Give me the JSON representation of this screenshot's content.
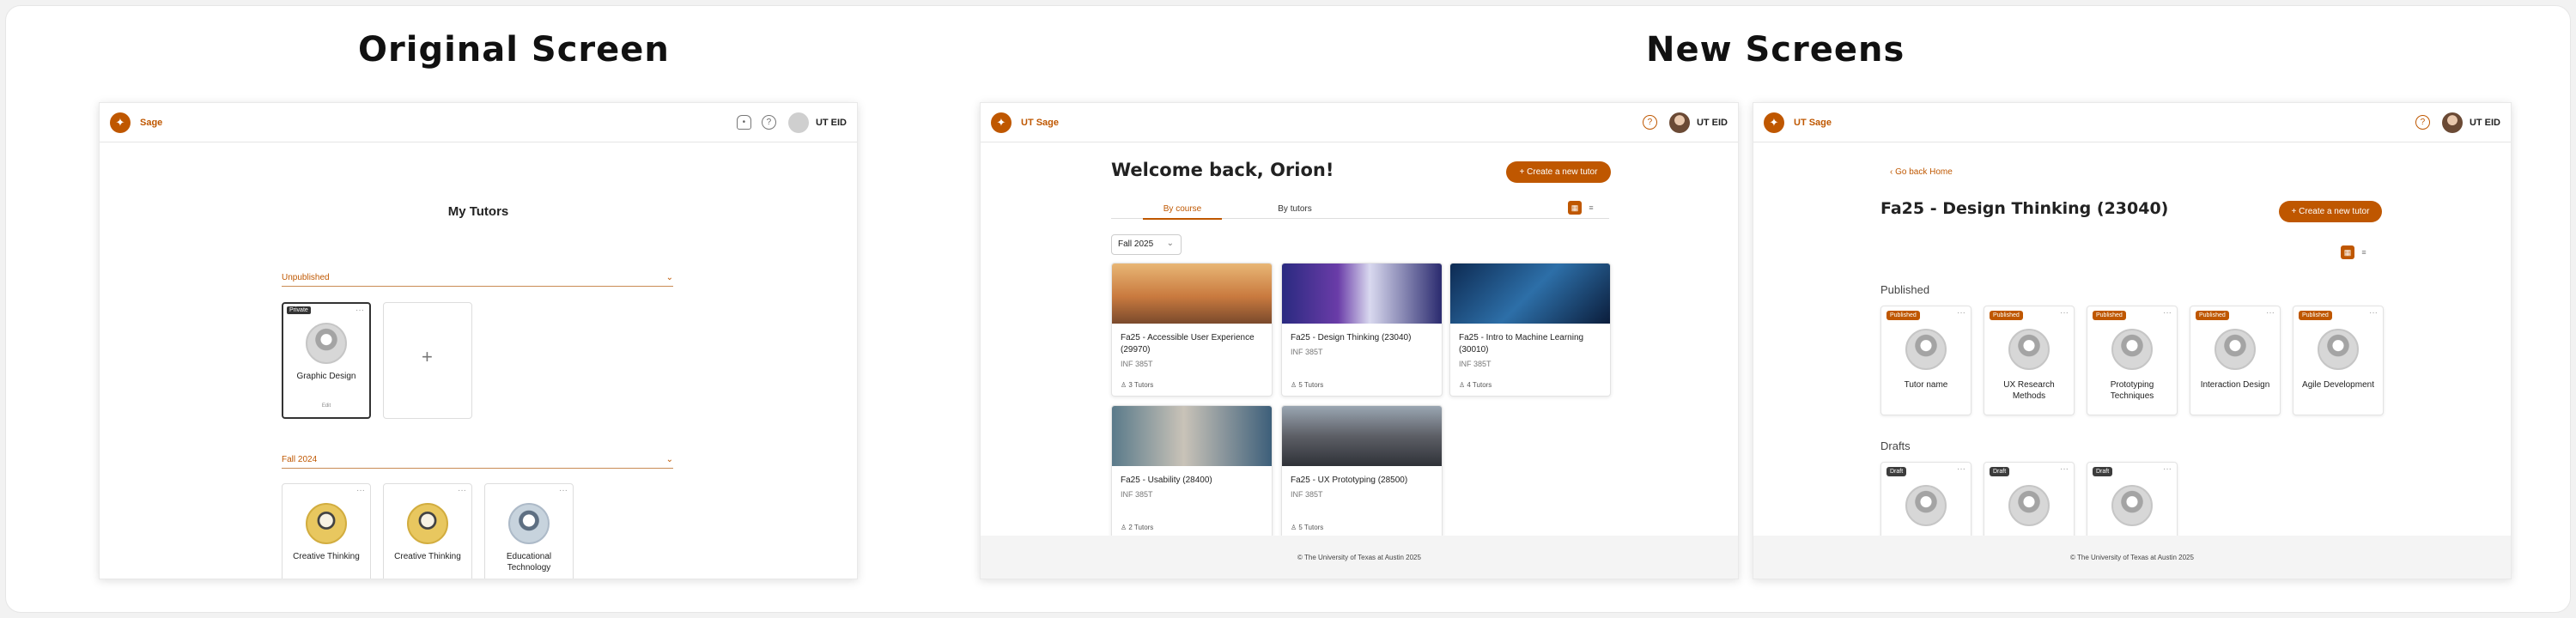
{
  "headings": {
    "original": "Original  Screen",
    "new": "New  Screens"
  },
  "original": {
    "brand": "Sage",
    "user": "UT EID",
    "title": "My Tutors",
    "groups": [
      {
        "label": "Unpublished",
        "cards": [
          {
            "tag": "Private",
            "name": "Graphic Design",
            "foot": "Edit"
          }
        ]
      },
      {
        "label": "Fall 2024",
        "cards": [
          {
            "name": "Creative Thinking"
          },
          {
            "name": "Creative Thinking"
          },
          {
            "name": "Educational Technology"
          }
        ]
      }
    ],
    "add_symbol": "+"
  },
  "screen2": {
    "brand": "UT Sage",
    "user": "UT EID",
    "welcome": "Welcome back, Orion!",
    "create_btn": "+ Create a new tutor",
    "tabs": [
      "By course",
      "By tutors"
    ],
    "term": "Fall 2025",
    "courses": [
      {
        "title": "Fa25 - Accessible User Experience (29970)",
        "code": "INF 385T",
        "count": "3 Tutors"
      },
      {
        "title": "Fa25 - Design Thinking (23040)",
        "code": "INF 385T",
        "count": "5 Tutors"
      },
      {
        "title": "Fa25 - Intro to Machine Learning (30010)",
        "code": "INF 385T",
        "count": "4 Tutors"
      },
      {
        "title": "Fa25 - Usability (28400)",
        "code": "INF 385T",
        "count": "2 Tutors"
      },
      {
        "title": "Fa25 - UX Prototyping (28500)",
        "code": "INF 385T",
        "count": "5 Tutors"
      }
    ],
    "footer": "© The University of Texas at Austin 2025"
  },
  "screen3": {
    "brand": "UT Sage",
    "user": "UT EID",
    "back": "‹ Go back Home",
    "title": "Fa25 - Design Thinking (23040)",
    "create_btn": "+ Create a new tutor",
    "published_label": "Published",
    "drafts_label": "Drafts",
    "published": [
      {
        "badge": "Published",
        "name": "Tutor name"
      },
      {
        "badge": "Published",
        "name": "UX Research Methods"
      },
      {
        "badge": "Published",
        "name": "Prototyping Techniques"
      },
      {
        "badge": "Published",
        "name": "Interaction Design"
      },
      {
        "badge": "Published",
        "name": "Agile Development"
      }
    ],
    "drafts": [
      {
        "badge": "Draft"
      },
      {
        "badge": "Draft"
      },
      {
        "badge": "Draft"
      }
    ],
    "footer": "© The University of Texas at Austin 2025"
  },
  "icons": {
    "logo": "longhorn-logo-icon",
    "bell": "bell-icon",
    "help": "help-icon",
    "more": "more-dots-icon",
    "chevron": "chevron-down-icon",
    "grid": "grid-view-icon",
    "list": "list-view-icon",
    "tutors": "tutors-icon"
  },
  "colors": {
    "accent": "#bf5700",
    "dark_badge": "#3c3c3c"
  }
}
